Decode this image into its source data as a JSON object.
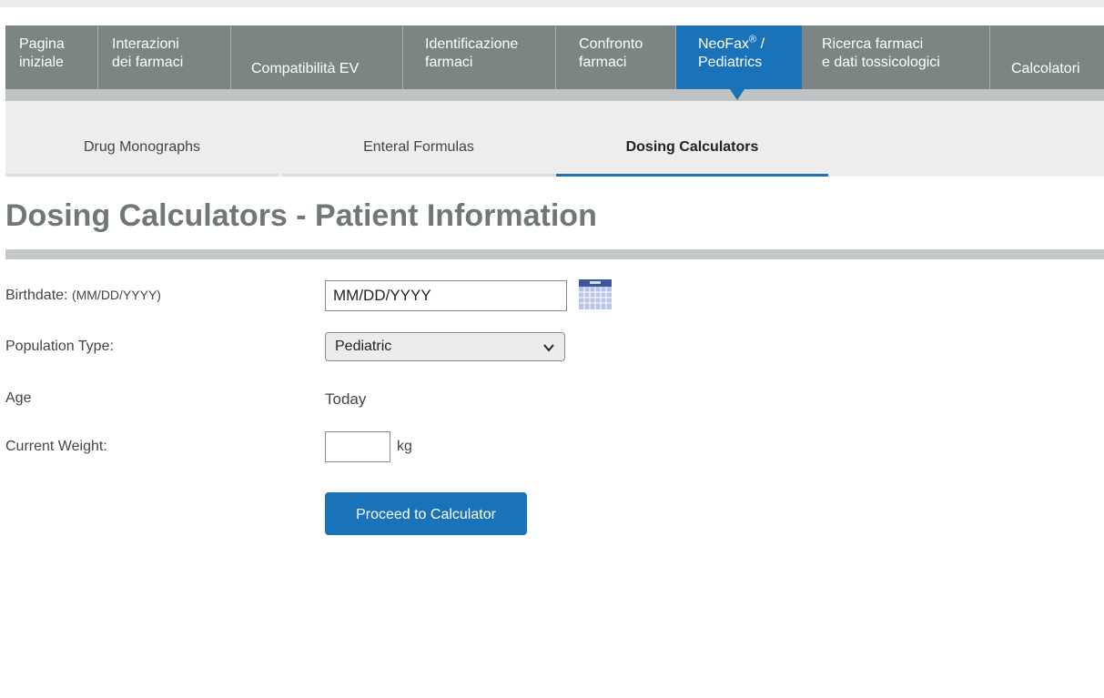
{
  "main_nav": {
    "tabs": [
      {
        "line1": "Pagina",
        "line2": "iniziale"
      },
      {
        "line1": "Interazioni",
        "line2": "dei farmaci"
      },
      {
        "line1": "Compatibilità EV"
      },
      {
        "line1": "Identificazione",
        "line2": "farmaci"
      },
      {
        "line1": "Confronto",
        "line2": "farmaci"
      },
      {
        "line1_pre": "NeoFax",
        "line1_sup": "®",
        "line1_post": " /",
        "line2": "Pediatrics",
        "active": true
      },
      {
        "line1": "Ricerca farmaci",
        "line2": "e dati tossicologici"
      },
      {
        "line1": "Calcolatori"
      }
    ]
  },
  "sub_nav": {
    "tabs": [
      {
        "label": "Drug Monographs"
      },
      {
        "label": "Enteral Formulas"
      },
      {
        "label": "Dosing Calculators",
        "active": true
      }
    ]
  },
  "page": {
    "title": "Dosing Calculators - Patient Information"
  },
  "form": {
    "birthdate": {
      "label": "Birthdate:",
      "hint": "(MM/DD/YYYY)",
      "value": "MM/DD/YYYY"
    },
    "population": {
      "label": "Population Type:",
      "selected": "Pediatric"
    },
    "age": {
      "label": "Age",
      "value": "Today"
    },
    "weight": {
      "label": "Current Weight:",
      "value": "",
      "unit": "kg"
    },
    "submit_label": "Proceed to Calculator"
  },
  "icons": {
    "calendar": "calendar-icon",
    "dropdown": "chevron-down-icon"
  },
  "colors": {
    "nav_bg": "#7b8584",
    "accent": "#1a73b8",
    "subnav_bg": "#ededed",
    "title": "#6f7777"
  }
}
